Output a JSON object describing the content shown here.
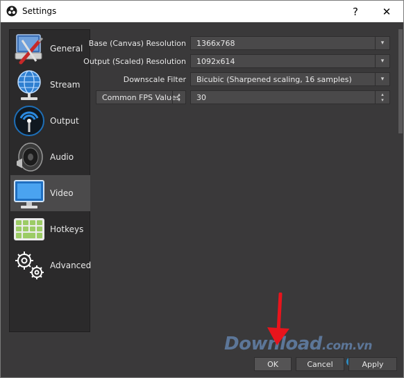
{
  "window": {
    "title": "Settings",
    "help_glyph": "?",
    "close_glyph": "✕"
  },
  "sidebar": {
    "items": [
      {
        "label": "General",
        "icon": "general-tools-icon"
      },
      {
        "label": "Stream",
        "icon": "globe-stream-icon"
      },
      {
        "label": "Output",
        "icon": "output-broadcast-icon"
      },
      {
        "label": "Audio",
        "icon": "speaker-icon"
      },
      {
        "label": "Video",
        "icon": "monitor-icon",
        "selected": true
      },
      {
        "label": "Hotkeys",
        "icon": "keyboard-icon"
      },
      {
        "label": "Advanced",
        "icon": "gears-icon"
      }
    ]
  },
  "video": {
    "base_resolution": {
      "label": "Base (Canvas) Resolution",
      "value": "1366x768"
    },
    "output_resolution": {
      "label": "Output (Scaled) Resolution",
      "value": "1092x614"
    },
    "downscale_filter": {
      "label": "Downscale Filter",
      "value": "Bicubic (Sharpened scaling, 16 samples)"
    },
    "fps": {
      "type_label": "Common FPS Values",
      "value": "30"
    }
  },
  "buttons": {
    "ok": "OK",
    "cancel": "Cancel",
    "apply": "Apply"
  },
  "watermark": {
    "text_main": "Download",
    "text_suffix": ".com.vn"
  },
  "colors": {
    "client_bg": "#3a393a",
    "sidebar_bg": "#2b2a2b",
    "selected_bg": "#4b4a4b",
    "arrow_red": "#e8141c"
  }
}
